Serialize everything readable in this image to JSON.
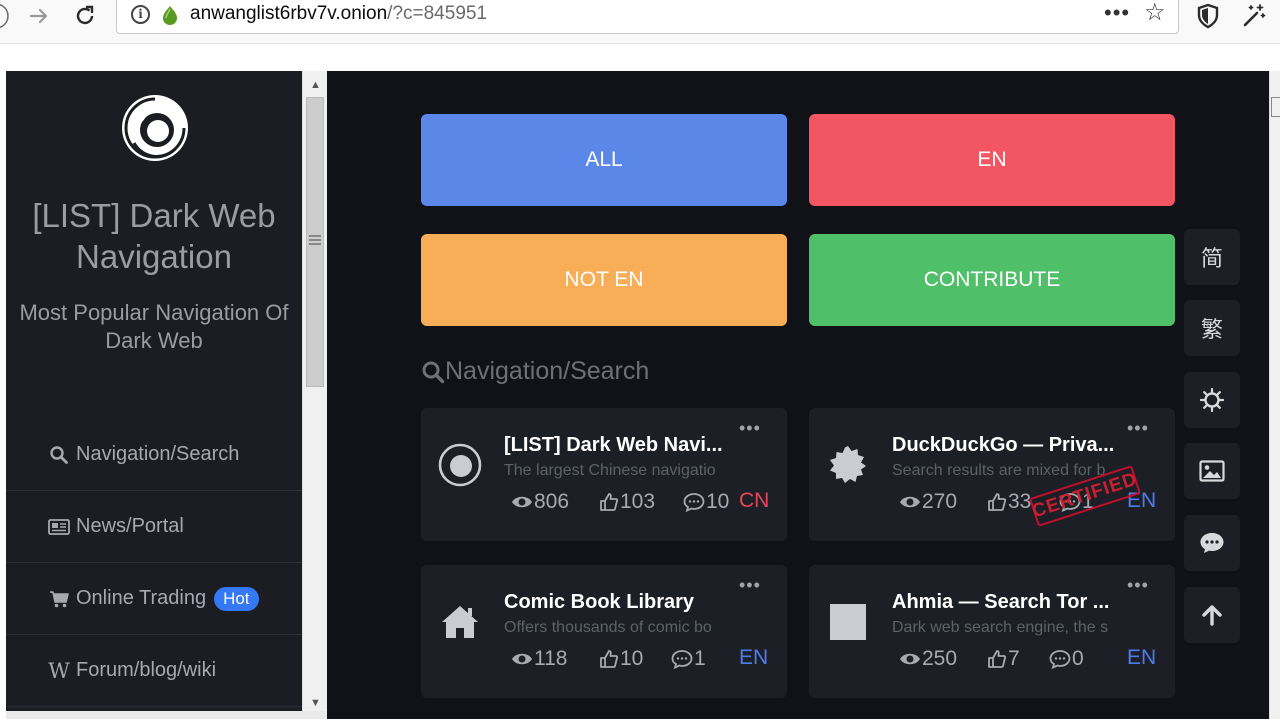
{
  "browser": {
    "url_host": "anwanglist6rbv7v.onion",
    "url_rest": "/?c=845951"
  },
  "sidebar": {
    "title": "[LIST] Dark Web Navigation",
    "subtitle": "Most Popular Navigation Of Dark Web",
    "items": [
      {
        "label": "Navigation/Search",
        "icon": "search-icon"
      },
      {
        "label": "News/Portal",
        "icon": "newspaper-icon"
      },
      {
        "label": "Online Trading",
        "icon": "cart-icon",
        "badge": "Hot"
      },
      {
        "label": "Forum/blog/wiki",
        "icon": "wikipedia-icon"
      }
    ]
  },
  "filters": {
    "all": "ALL",
    "en": "EN",
    "not_en": "NOT EN",
    "contribute": "CONTRIBUTE"
  },
  "section": {
    "title": "Navigation/Search"
  },
  "cards": [
    {
      "title": "[LIST] Dark Web Navi...",
      "desc": "The largest Chinese navigatio",
      "views": "806",
      "likes": "103",
      "comments": "10",
      "lang": "CN",
      "icon": "darkweb-logo-icon"
    },
    {
      "title": "DuckDuckGo — Priva...",
      "desc": "Search results are mixed for b",
      "views": "270",
      "likes": "33",
      "comments": "1",
      "lang": "EN",
      "stamp": "CERTIFIED",
      "icon": "gear-badge-icon"
    },
    {
      "title": "Comic Book Library",
      "desc": "Offers thousands of comic bo",
      "views": "118",
      "likes": "10",
      "comments": "1",
      "lang": "EN",
      "icon": "home-icon"
    },
    {
      "title": "Ahmia — Search Tor ...",
      "desc": "Dark web search engine, the s",
      "views": "250",
      "likes": "7",
      "comments": "0",
      "lang": "EN",
      "icon": "placeholder-square-icon"
    }
  ],
  "tools": {
    "simplified": "简",
    "traditional": "繁"
  },
  "colors": {
    "all": "#5b88e8",
    "en": "#f25662",
    "not_en": "#f7ae57",
    "contribute": "#4fbf69",
    "cn_lang": "#e8455a",
    "en_lang": "#4f7bf0"
  }
}
